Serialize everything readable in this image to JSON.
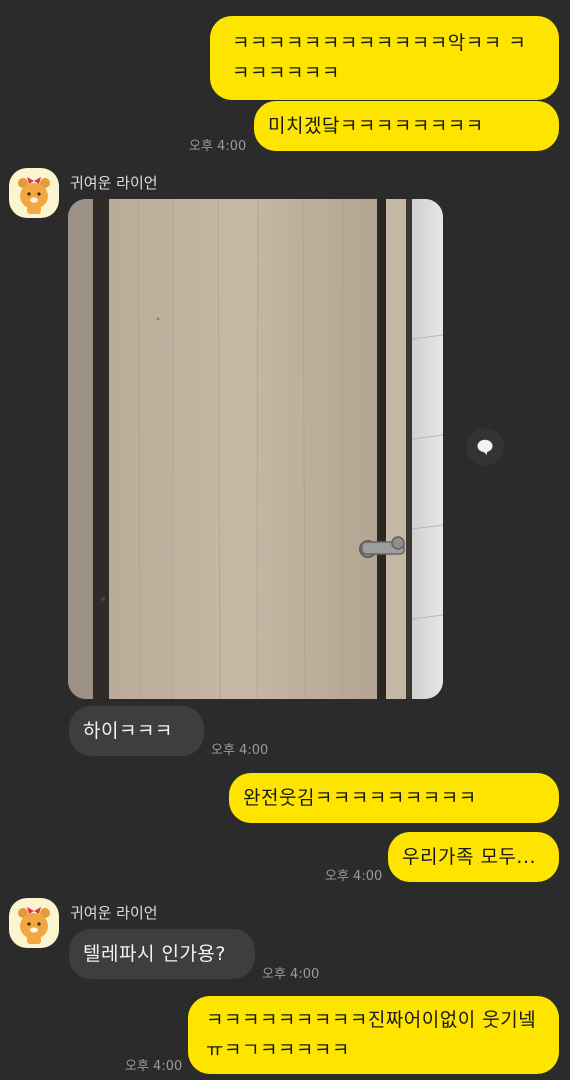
{
  "messages": {
    "m1_text": "ㅋㅋㅋㅋㅋㅋㅋㅋㅋㅋㅋㅋ악ㅋㅋ ㅋㅋㅋㅋㅋㅋㅋ",
    "m2_text": "미치겠닼ㅋㅋㅋㅋㅋㅋㅋㅋ",
    "m2_time": "오후 4:00",
    "sender1_name": "귀여운 라이언",
    "m4_text": "하이ㅋㅋㅋ",
    "m4_time": "오후 4:00",
    "m5_text": "완전웃김ㅋㅋㅋㅋㅋㅋㅋㅋㅋ",
    "m6_text": "우리가족 모두...",
    "m6_time": "오후 4:00",
    "sender2_name": "귀여운 라이언",
    "m7_text": "텔레파시 인가용?",
    "m7_time": "오후 4:00",
    "m8_text": "ㅋㅋㅋㅋㅋㅋㅋㅋㅋ진짜어이없이 웃기넼ㅠㅋㄱㅋㅋㅋㅋㅋ",
    "m8_time": "오후 4:00"
  },
  "icons": {
    "avatar": "ryan-character-icon",
    "share": "share-speech-bubble-icon"
  },
  "colors": {
    "background": "#2b2b2b",
    "my_bubble": "#fee500",
    "their_bubble": "#3e3e3e",
    "timestamp": "#9a9a9a"
  }
}
